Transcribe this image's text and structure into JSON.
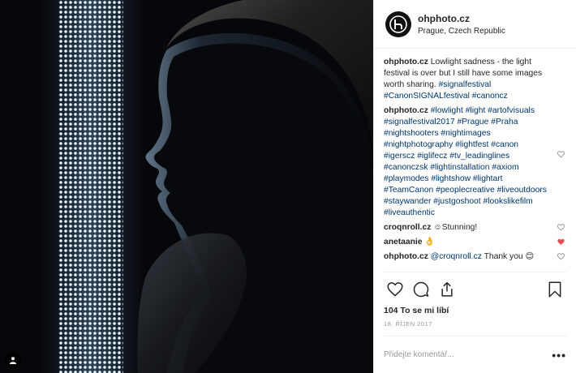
{
  "header": {
    "username": "ohphoto.cz",
    "location": "Prague, Czech Republic"
  },
  "colors": {
    "hashtag": "#003569",
    "heart_liked": "#ed4956",
    "text": "#262626",
    "muted": "#999999"
  },
  "comments": [
    {
      "user": "ohphoto.cz",
      "text": "Lowlight sadness - the light festival is over but I still have some images worth sharing.",
      "tags": "#signalfestival #CanonSIGNALfestival #canoncz",
      "heart": ""
    },
    {
      "user": "ohphoto.cz",
      "text": "",
      "tags": "#lowlight #light #artofvisuals #signalfestival2017 #Prague #Praha #nightshooters #nightimages #nightphotography #lightfest #canon #igerscz #iglifecz #tv_leadinglines #canonczsk #lightinstallation #axiom #playmodes #lightshow #lightart #TeamCanon #peoplecreative #liveoutdoors #staywander #justgoshoot #lookslikefilm #liveauthentic",
      "heart": "outline"
    },
    {
      "user": "croqnroll.cz",
      "text": "☺Stunning!",
      "tags": "",
      "heart": "outline"
    },
    {
      "user": "anetaanie",
      "text": "👌",
      "tags": "",
      "heart": "filled"
    },
    {
      "user": "ohphoto.cz",
      "text": "Thank you 😊",
      "tags": "@croqnroll.cz",
      "heart": "outline"
    }
  ],
  "actions": {
    "like_icon": "heart-icon",
    "comment_icon": "comment-icon",
    "share_icon": "share-icon",
    "save_icon": "bookmark-icon"
  },
  "likes_text": "104 To se mi líbí",
  "date_text": "18. ŘÍJEN 2017",
  "add_comment": {
    "placeholder": "Přidejte komentář...",
    "more": "•••"
  }
}
